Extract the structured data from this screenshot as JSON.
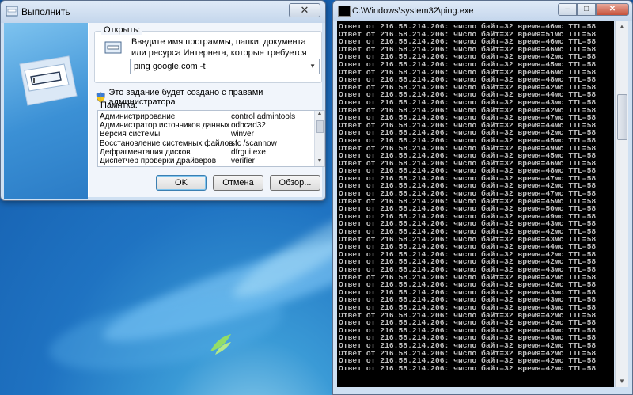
{
  "run_dialog": {
    "title": "Выполнить",
    "close_glyph": "✕",
    "open_label": "Открыть:",
    "description": "Введите имя программы, папки, документа или ресурса Интернета, которые требуется открыть.",
    "command_value": "ping google.com -t",
    "admin_note": "Это задание будет создано с правами администратора",
    "memo_label": "Памятка:",
    "memo_items": [
      {
        "name": "Администрирование",
        "cmd": "control admintools"
      },
      {
        "name": "Администратор источников данных",
        "cmd": "odbcad32"
      },
      {
        "name": "Версия системы",
        "cmd": "winver"
      },
      {
        "name": "Восстановление системных файлов",
        "cmd": "sfc /scannow"
      },
      {
        "name": "Дефрагментация дисков",
        "cmd": "dfrgui.exe"
      },
      {
        "name": "Диспетчер проверки драйверов",
        "cmd": "verifier"
      }
    ],
    "buttons": {
      "ok": "OK",
      "cancel": "Отмена",
      "browse": "Обзор..."
    },
    "colors": {
      "accent": "#3b90d5"
    }
  },
  "console": {
    "title": "C:\\Windows\\system32\\ping.exe",
    "lines": [
      "Ответ от 216.58.214.206: число байт=32 время=46мс TTL=58",
      "Ответ от 216.58.214.206: число байт=32 время=51мс TTL=58",
      "Ответ от 216.58.214.206: число байт=32 время=46мс TTL=58",
      "Ответ от 216.58.214.206: число байт=32 время=46мс TTL=58",
      "Ответ от 216.58.214.206: число байт=32 время=42мс TTL=58",
      "Ответ от 216.58.214.206: число байт=32 время=45мс TTL=58",
      "Ответ от 216.58.214.206: число байт=32 время=46мс TTL=58",
      "Ответ от 216.58.214.206: число байт=32 время=48мс TTL=58",
      "Ответ от 216.58.214.206: число байт=32 время=42мс TTL=58",
      "Ответ от 216.58.214.206: число байт=32 время=44мс TTL=58",
      "Ответ от 216.58.214.206: число байт=32 время=43мс TTL=58",
      "Ответ от 216.58.214.206: число байт=32 время=42мс TTL=58",
      "Ответ от 216.58.214.206: число байт=32 время=47мс TTL=58",
      "Ответ от 216.58.214.206: число байт=32 время=44мс TTL=58",
      "Ответ от 216.58.214.206: число байт=32 время=42мс TTL=58",
      "Ответ от 216.58.214.206: число байт=32 время=45мс TTL=58",
      "Ответ от 216.58.214.206: число байт=32 время=49мс TTL=58",
      "Ответ от 216.58.214.206: число байт=32 время=45мс TTL=58",
      "Ответ от 216.58.214.206: число байт=32 время=46мс TTL=58",
      "Ответ от 216.58.214.206: число байт=32 время=48мс TTL=58",
      "Ответ от 216.58.214.206: число байт=32 время=47мс TTL=58",
      "Ответ от 216.58.214.206: число байт=32 время=42мс TTL=58",
      "Ответ от 216.58.214.206: число байт=32 время=47мс TTL=58",
      "Ответ от 216.58.214.206: число байт=32 время=45мс TTL=58",
      "Ответ от 216.58.214.206: число байт=32 время=50мс TTL=58",
      "Ответ от 216.58.214.206: число байт=32 время=49мс TTL=58",
      "Ответ от 216.58.214.206: число байт=32 время=43мс TTL=58",
      "Ответ от 216.58.214.206: число байт=32 время=42мс TTL=58",
      "Ответ от 216.58.214.206: число байт=32 время=43мс TTL=58",
      "Ответ от 216.58.214.206: число байт=32 время=44мс TTL=58",
      "Ответ от 216.58.214.206: число байт=32 время=42мс TTL=58",
      "Ответ от 216.58.214.206: число байт=32 время=42мс TTL=58",
      "Ответ от 216.58.214.206: число байт=32 время=43мс TTL=58",
      "Ответ от 216.58.214.206: число байт=32 время=42мс TTL=58",
      "Ответ от 216.58.214.206: число байт=32 время=42мс TTL=58",
      "Ответ от 216.58.214.206: число байт=32 время=43мс TTL=58",
      "Ответ от 216.58.214.206: число байт=32 время=43мс TTL=58",
      "Ответ от 216.58.214.206: число байт=32 время=43мс TTL=58",
      "Ответ от 216.58.214.206: число байт=32 время=42мс TTL=58",
      "Ответ от 216.58.214.206: число байт=32 время=42мс TTL=58",
      "Ответ от 216.58.214.206: число байт=32 время=44мс TTL=58",
      "Ответ от 216.58.214.206: число байт=32 время=43мс TTL=58",
      "Ответ от 216.58.214.206: число байт=32 время=42мс TTL=58",
      "Ответ от 216.58.214.206: число байт=32 время=42мс TTL=58",
      "Ответ от 216.58.214.206: число байт=32 время=42мс TTL=58",
      "Ответ от 216.58.214.206: число байт=32 время=42мс TTL=58"
    ]
  }
}
